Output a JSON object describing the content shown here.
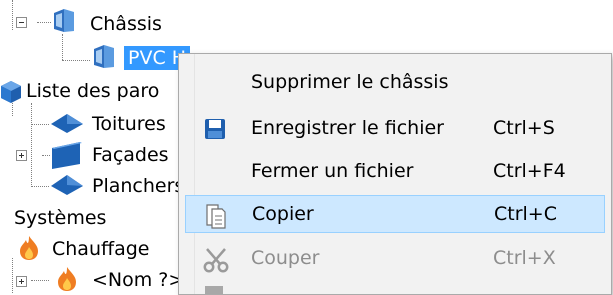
{
  "tree": {
    "chassis": "Châssis",
    "pvc_partial": "PVC H",
    "liste_parois": "Liste des paro",
    "toitures": "Toitures",
    "facades": "Façades",
    "planchers": "Planchers",
    "systemes": "Systèmes",
    "chauffage": "Chauffage",
    "nom": "<Nom ?>"
  },
  "context_menu": {
    "items": [
      {
        "label": "Supprimer le châssis",
        "shortcut": "",
        "enabled": true,
        "icon": ""
      },
      {
        "label": "Enregistrer le fichier",
        "shortcut": "Ctrl+S",
        "enabled": true,
        "icon": "save-icon"
      },
      {
        "label": "Fermer un fichier",
        "shortcut": "Ctrl+F4",
        "enabled": true,
        "icon": ""
      },
      {
        "label": "Copier",
        "shortcut": "Ctrl+C",
        "enabled": true,
        "icon": "copy-icon"
      },
      {
        "label": "Couper",
        "shortcut": "Ctrl+X",
        "enabled": false,
        "icon": "scissors-icon"
      }
    ]
  },
  "colors": {
    "selection": "#3399ff",
    "menu_hover": "#cde8ff",
    "menu_background": "#f2f2f2"
  }
}
